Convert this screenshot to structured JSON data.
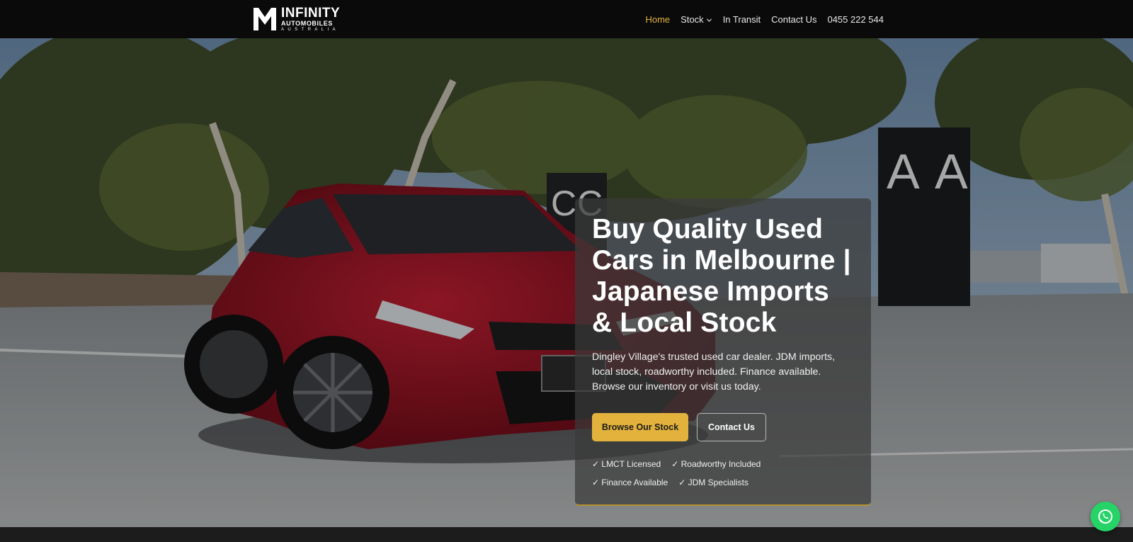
{
  "logo": {
    "line1": "INFINITY",
    "line2": "AUTOMOBILES",
    "line3": "AUSTRALIA"
  },
  "nav": {
    "items": [
      {
        "label": "Home",
        "active": true
      },
      {
        "label": "Stock",
        "has_dropdown": true
      },
      {
        "label": "In Transit"
      },
      {
        "label": "Contact Us"
      },
      {
        "label": "0455 222 544"
      }
    ]
  },
  "hero": {
    "title": "Buy Quality Used Cars in Melbourne | Japanese Imports & Local Stock",
    "description": "Dingley Village's trusted used car dealer. JDM imports, local stock, roadworthy included. Finance available. Browse our inventory or visit us today.",
    "primary_cta": "Browse Our Stock",
    "secondary_cta": "Contact Us",
    "badges": [
      "✓ LMCT Licensed",
      "✓ Roadworthy Included",
      "✓ Finance Available",
      "✓ JDM Specialists"
    ],
    "signage_letters": [
      "C",
      "C",
      "A",
      "A"
    ]
  },
  "colors": {
    "accent": "#e3b23c",
    "nav_bg": "#0a0a0a",
    "whatsapp": "#25d366",
    "car_red": "#9c1424"
  },
  "icons": {
    "whatsapp": "whatsapp-icon",
    "dropdown": "chevron-down-icon"
  }
}
